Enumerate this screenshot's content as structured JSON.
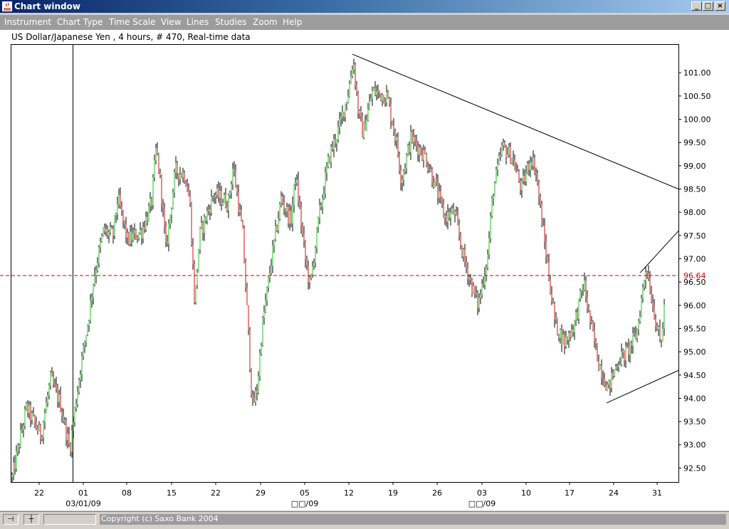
{
  "window": {
    "title": "Chart window",
    "minimize_glyph": "_",
    "maximize_glyph": "□",
    "close_glyph": "×"
  },
  "menu": {
    "items": [
      "Instrument",
      "Chart Type",
      "Time Scale",
      "View",
      "Lines",
      "Studies",
      "Zoom",
      "Help"
    ]
  },
  "chart": {
    "header": "US Dollar/Japanese Yen , 4 hours, # 470, Real-time data",
    "current_price": "96.64",
    "colors": {
      "up": "#22c022",
      "down": "#cc1010",
      "grid": "#000000",
      "current_line": "#cc0000"
    }
  },
  "chart_data": {
    "type": "candlestick",
    "instrument": "US Dollar/Japanese Yen",
    "timeframe": "4 hours",
    "bar_count": 470,
    "current_price": 96.64,
    "y_ticks": [
      "92.50",
      "93.00",
      "93.50",
      "94.00",
      "94.50",
      "95.00",
      "95.50",
      "96.00",
      "96.50",
      "97.00",
      "97.50",
      "98.00",
      "98.50",
      "99.00",
      "99.50",
      "100.00",
      "100.50",
      "101.00"
    ],
    "x_ticks": [
      "22",
      "01",
      "08",
      "15",
      "22",
      "29",
      "05",
      "12",
      "19",
      "26",
      "03",
      "10",
      "17",
      "24",
      "31"
    ],
    "x_sublabels": [
      "03/01/09",
      "□□/09",
      "□□/09"
    ],
    "ylim": [
      92.2,
      101.6
    ],
    "price_path": [
      [
        0,
        92.3
      ],
      [
        3,
        93.8
      ],
      [
        6,
        93.2
      ],
      [
        8,
        94.4
      ],
      [
        10,
        93.9
      ],
      [
        12,
        92.9
      ],
      [
        14,
        94.5
      ],
      [
        16,
        95.8
      ],
      [
        17,
        96.6
      ],
      [
        19,
        97.6
      ],
      [
        21,
        97.5
      ],
      [
        22,
        98.3
      ],
      [
        24,
        97.4
      ],
      [
        27,
        97.6
      ],
      [
        29,
        98.2
      ],
      [
        30,
        99.4
      ],
      [
        31,
        98.5
      ],
      [
        32,
        97.2
      ],
      [
        34,
        98.9
      ],
      [
        36,
        98.8
      ],
      [
        37,
        98.2
      ],
      [
        38,
        96.0
      ],
      [
        39,
        97.5
      ],
      [
        42,
        98.4
      ],
      [
        45,
        98.2
      ],
      [
        46,
        99.0
      ],
      [
        48,
        97.5
      ],
      [
        49,
        95.7
      ],
      [
        50,
        93.8
      ],
      [
        51,
        94.2
      ],
      [
        52,
        95.5
      ],
      [
        54,
        97.0
      ],
      [
        56,
        98.3
      ],
      [
        58,
        97.8
      ],
      [
        59,
        98.8
      ],
      [
        61,
        97.0
      ],
      [
        62,
        96.4
      ],
      [
        64,
        98.0
      ],
      [
        66,
        99.2
      ],
      [
        68,
        99.8
      ],
      [
        70,
        100.6
      ],
      [
        71,
        101.3
      ],
      [
        72,
        100.2
      ],
      [
        73,
        99.7
      ],
      [
        75,
        100.6
      ],
      [
        78,
        100.5
      ],
      [
        80,
        99.5
      ],
      [
        81,
        98.7
      ],
      [
        83,
        99.6
      ],
      [
        86,
        99.2
      ],
      [
        88,
        98.6
      ],
      [
        90,
        97.9
      ],
      [
        92,
        98.0
      ],
      [
        94,
        97.0
      ],
      [
        96,
        96.3
      ],
      [
        97,
        96.0
      ],
      [
        99,
        97.1
      ],
      [
        100,
        98.4
      ],
      [
        102,
        99.4
      ],
      [
        104,
        99.2
      ],
      [
        106,
        98.5
      ],
      [
        108,
        99.2
      ],
      [
        109,
        98.9
      ],
      [
        110,
        98.0
      ],
      [
        112,
        96.4
      ],
      [
        113,
        95.6
      ],
      [
        115,
        95.2
      ],
      [
        117,
        95.6
      ],
      [
        119,
        96.5
      ],
      [
        120,
        95.8
      ],
      [
        122,
        94.8
      ],
      [
        124,
        94.2
      ],
      [
        126,
        94.8
      ],
      [
        128,
        95.0
      ],
      [
        130,
        95.4
      ],
      [
        132,
        96.9
      ],
      [
        133,
        96.2
      ],
      [
        135,
        95.1
      ],
      [
        136,
        96.3
      ]
    ],
    "drawn_lines": [
      {
        "name": "resistance",
        "from": [
          71,
          101.4
        ],
        "to": [
          141,
          98.5
        ]
      },
      {
        "name": "channel-top",
        "from": [
          131,
          96.7
        ],
        "to": [
          141,
          97.6
        ]
      },
      {
        "name": "channel-bottom",
        "from": [
          124,
          93.9
        ],
        "to": [
          139,
          94.6
        ]
      }
    ]
  },
  "status": {
    "pin_glyph": "⊣",
    "cross_glyph": "┼",
    "copyright": "Copyright (c) Saxo Bank 2004"
  }
}
